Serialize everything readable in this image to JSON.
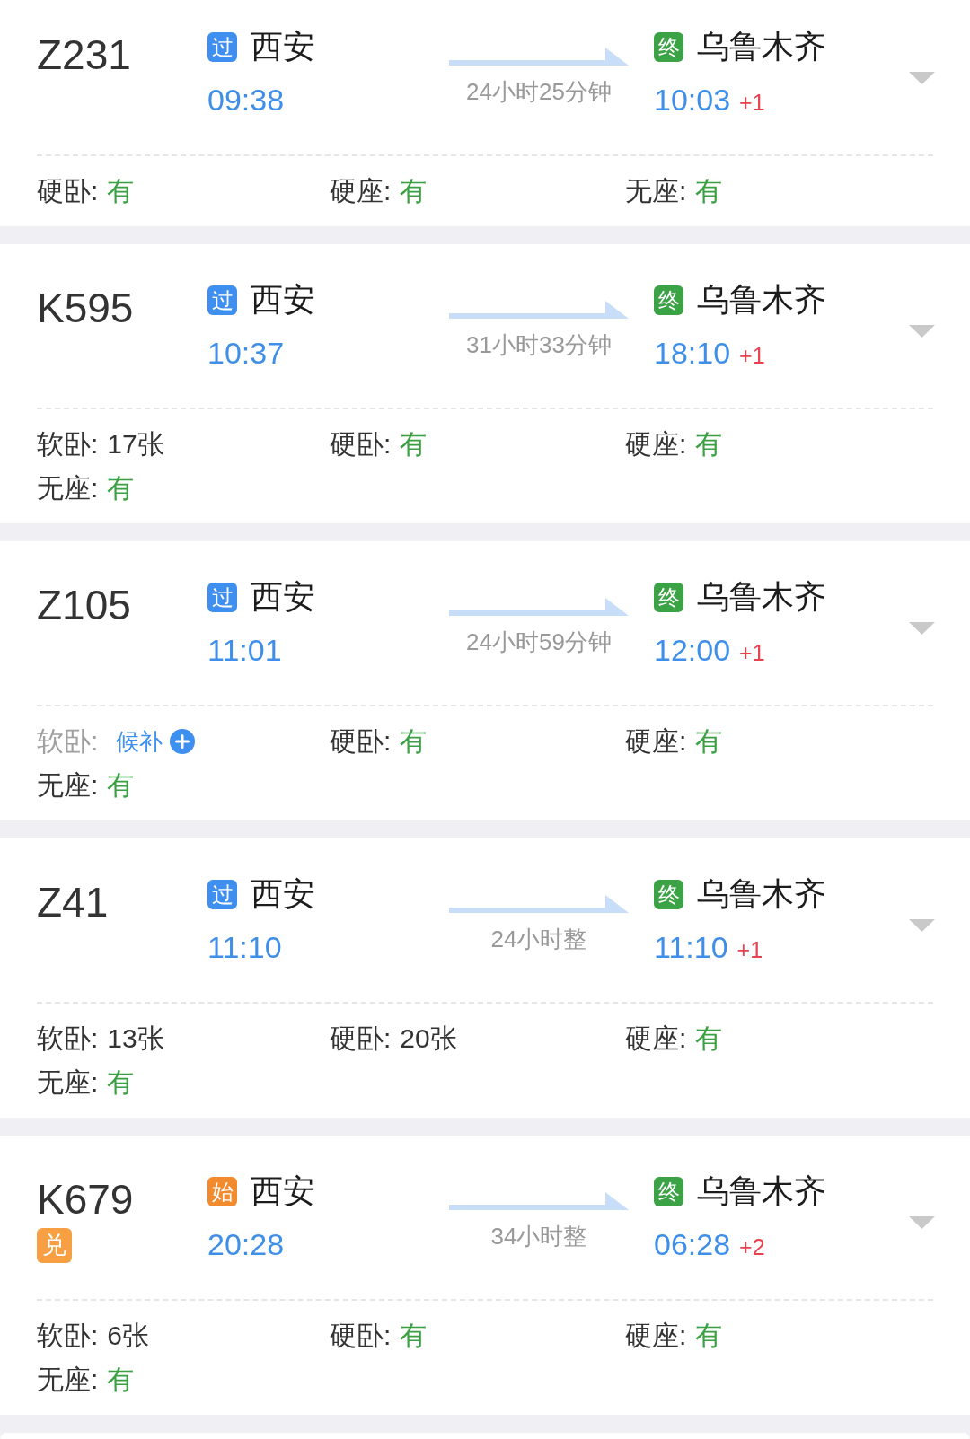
{
  "trains": [
    {
      "number": "Z231",
      "expanded": false,
      "from": {
        "tag": {
          "text": "过",
          "color": "#3f8ff0"
        },
        "station": "西安",
        "time": "09:38"
      },
      "duration": "24小时25分钟",
      "to": {
        "tag": {
          "text": "终",
          "color": "#3ba245"
        },
        "station": "乌鲁木齐",
        "time": "10:03",
        "day_offset": "+1"
      },
      "seats": [
        {
          "kind": "available",
          "label": "硬卧:",
          "value": "有"
        },
        {
          "kind": "available",
          "label": "硬座:",
          "value": "有"
        },
        {
          "kind": "available",
          "label": "无座:",
          "value": "有"
        }
      ]
    },
    {
      "number": "K595",
      "expanded": false,
      "from": {
        "tag": {
          "text": "过",
          "color": "#3f8ff0"
        },
        "station": "西安",
        "time": "10:37"
      },
      "duration": "31小时33分钟",
      "to": {
        "tag": {
          "text": "终",
          "color": "#3ba245"
        },
        "station": "乌鲁木齐",
        "time": "18:10",
        "day_offset": "+1"
      },
      "seats": [
        {
          "kind": "count",
          "label": "软卧:",
          "value": "17张"
        },
        {
          "kind": "available",
          "label": "硬卧:",
          "value": "有"
        },
        {
          "kind": "available",
          "label": "硬座:",
          "value": "有"
        },
        {
          "kind": "available",
          "label": "无座:",
          "value": "有"
        }
      ]
    },
    {
      "number": "Z105",
      "expanded": false,
      "from": {
        "tag": {
          "text": "过",
          "color": "#3f8ff0"
        },
        "station": "西安",
        "time": "11:01"
      },
      "duration": "24小时59分钟",
      "to": {
        "tag": {
          "text": "终",
          "color": "#3ba245"
        },
        "station": "乌鲁木齐",
        "time": "12:00",
        "day_offset": "+1"
      },
      "seats": [
        {
          "kind": "waitlist",
          "label": "软卧:",
          "value": "候补"
        },
        {
          "kind": "available",
          "label": "硬卧:",
          "value": "有"
        },
        {
          "kind": "available",
          "label": "硬座:",
          "value": "有"
        },
        {
          "kind": "available",
          "label": "无座:",
          "value": "有"
        }
      ]
    },
    {
      "number": "Z41",
      "expanded": false,
      "from": {
        "tag": {
          "text": "过",
          "color": "#3f8ff0"
        },
        "station": "西安",
        "time": "11:10"
      },
      "duration": "24小时整",
      "to": {
        "tag": {
          "text": "终",
          "color": "#3ba245"
        },
        "station": "乌鲁木齐",
        "time": "11:10",
        "day_offset": "+1"
      },
      "seats": [
        {
          "kind": "count",
          "label": "软卧:",
          "value": "13张"
        },
        {
          "kind": "count",
          "label": "硬卧:",
          "value": "20张"
        },
        {
          "kind": "available",
          "label": "硬座:",
          "value": "有"
        },
        {
          "kind": "available",
          "label": "无座:",
          "value": "有"
        }
      ]
    },
    {
      "number": "K679",
      "train_tag": "兑",
      "expanded": false,
      "from": {
        "tag": {
          "text": "始",
          "color": "#f28a2e"
        },
        "station": "西安",
        "time": "20:28"
      },
      "duration": "34小时整",
      "to": {
        "tag": {
          "text": "终",
          "color": "#3ba245"
        },
        "station": "乌鲁木齐",
        "time": "06:28",
        "day_offset": "+2"
      },
      "seats": [
        {
          "kind": "count",
          "label": "软卧:",
          "value": "6张"
        },
        {
          "kind": "available",
          "label": "硬卧:",
          "value": "有"
        },
        {
          "kind": "available",
          "label": "硬座:",
          "value": "有"
        },
        {
          "kind": "available",
          "label": "无座:",
          "value": "有"
        }
      ]
    }
  ]
}
